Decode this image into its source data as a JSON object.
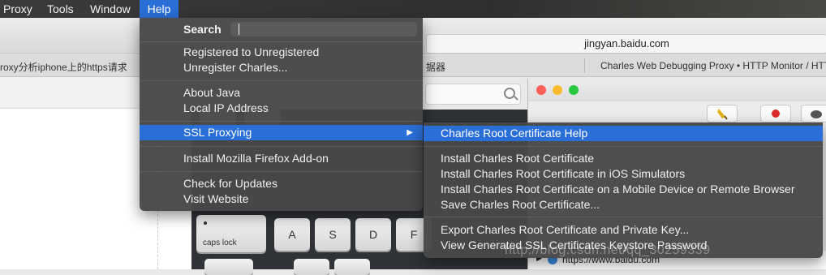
{
  "menubar": {
    "items": [
      "Proxy",
      "Tools",
      "Window",
      "Help"
    ]
  },
  "browser": {
    "url": "jingyan.baidu.com",
    "tabs": [
      "roxy分析iphone上的https请求",
      "据器",
      "Charles Web Debugging Proxy • HTTP Monitor / HTTP"
    ]
  },
  "keyboard": {
    "caps_label": "caps lock",
    "keys": [
      "A",
      "S",
      "D",
      "F"
    ]
  },
  "help_menu": {
    "search_label": "Search",
    "groups": [
      [
        "Registered to Unregistered",
        "Unregister Charles..."
      ],
      [
        "About Java",
        "Local IP Address"
      ],
      [
        "SSL Proxying"
      ],
      [
        "Install Mozilla Firefox Add-on"
      ],
      [
        "Check for Updates",
        "Visit Website"
      ]
    ],
    "highlighted": "SSL Proxying",
    "submenu_arrow": "▶"
  },
  "ssl_submenu": {
    "groups": [
      [
        "Charles Root Certificate Help"
      ],
      [
        "Install Charles Root Certificate",
        "Install Charles Root Certificate in iOS Simulators",
        "Install Charles Root Certificate on a Mobile Device or Remote Browser",
        "Save Charles Root Certificate..."
      ],
      [
        "Export Charles Root Certificate and Private Key...",
        "View Generated SSL Certificates Keystore Password"
      ]
    ],
    "highlighted": "Charles Root Certificate Help"
  },
  "charles_window": {
    "tree_item": "https://www.baidu.com"
  },
  "watermark": "http://blog.csdn.net/qq_30259339",
  "colors": {
    "highlight": "#2a6fd8",
    "menu_bg": "#484848",
    "traffic_red": "#fc5f57",
    "traffic_yellow": "#fdbc2e",
    "traffic_green": "#28c840"
  }
}
